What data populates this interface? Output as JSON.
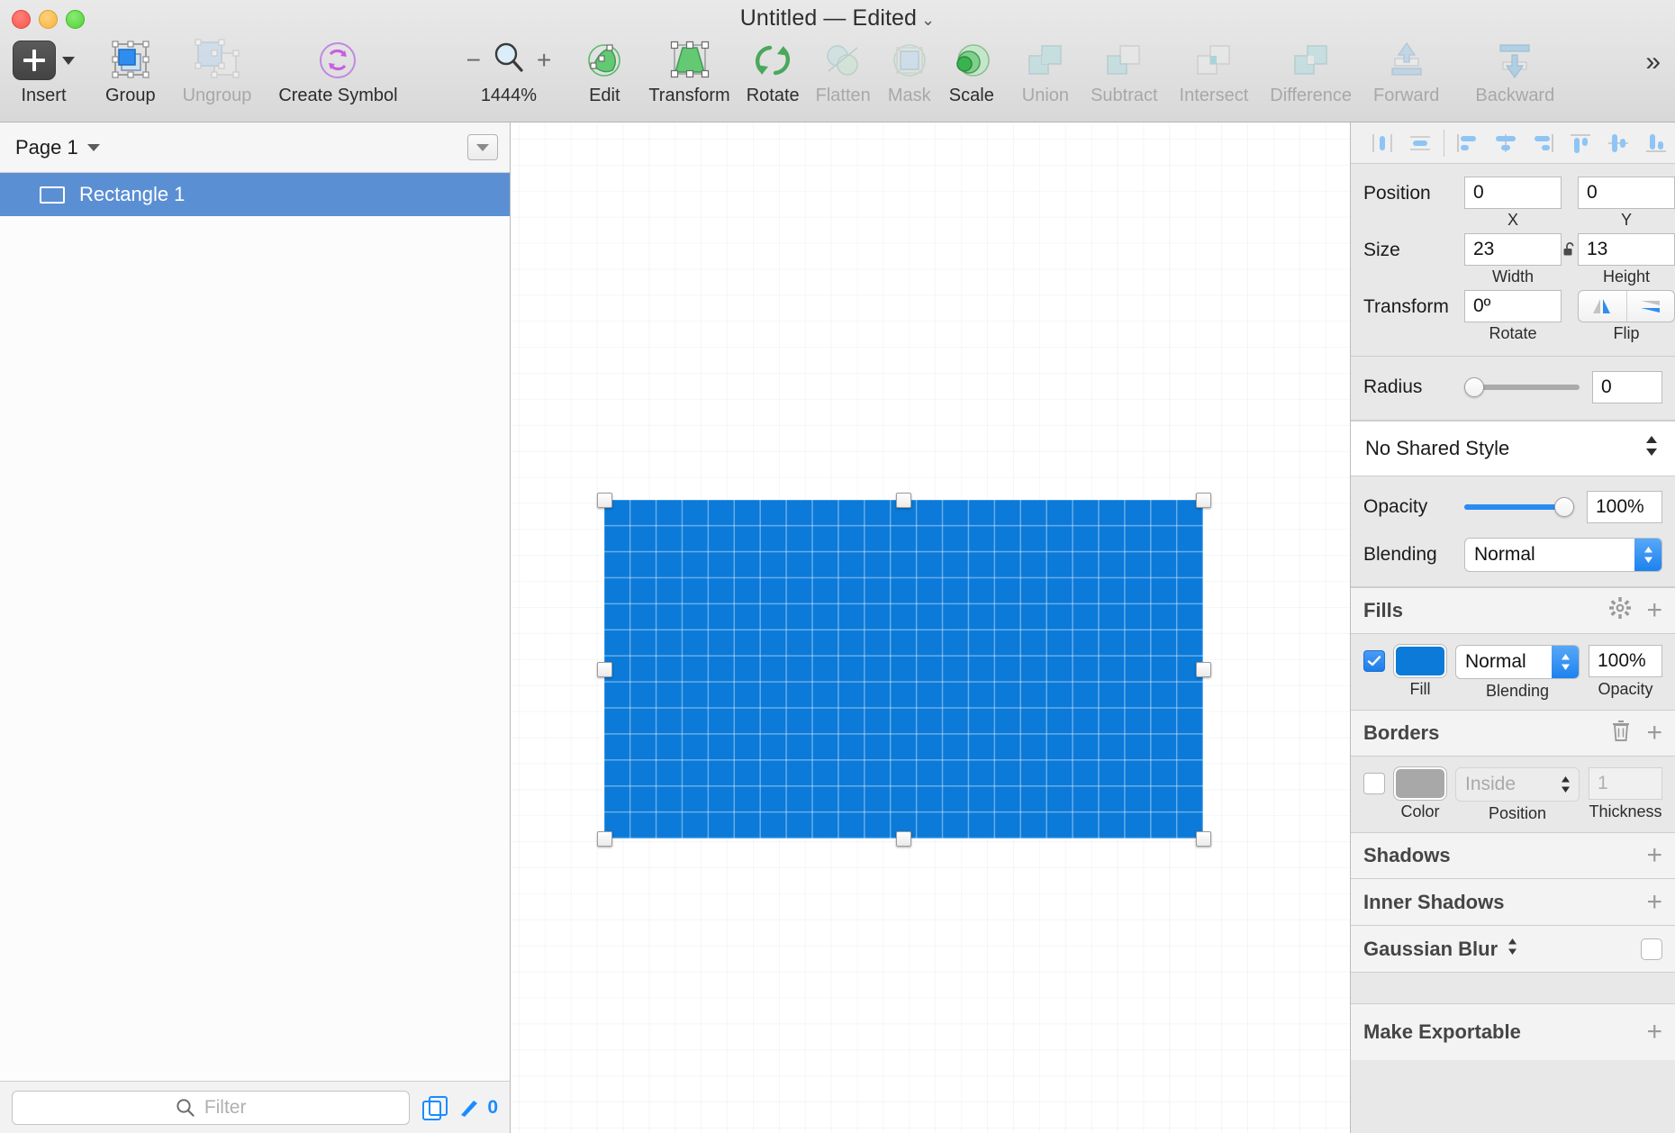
{
  "window": {
    "title": "Untitled — Edited",
    "title_chevron": "chevron-down-icon"
  },
  "toolbar": {
    "items": [
      {
        "label": "Insert",
        "icon": "insert-plus-icon",
        "enabled": true
      },
      {
        "label": "Group",
        "icon": "group-icon",
        "enabled": true
      },
      {
        "label": "Ungroup",
        "icon": "ungroup-icon",
        "enabled": false
      },
      {
        "label": "Create Symbol",
        "icon": "create-symbol-icon",
        "enabled": true
      },
      {
        "label": "Edit",
        "icon": "edit-icon",
        "enabled": true
      },
      {
        "label": "Transform",
        "icon": "transform-icon",
        "enabled": true
      },
      {
        "label": "Rotate",
        "icon": "rotate-icon",
        "enabled": true
      },
      {
        "label": "Flatten",
        "icon": "flatten-icon",
        "enabled": false
      },
      {
        "label": "Mask",
        "icon": "mask-icon",
        "enabled": false
      },
      {
        "label": "Scale",
        "icon": "scale-icon",
        "enabled": true
      },
      {
        "label": "Union",
        "icon": "union-icon",
        "enabled": false
      },
      {
        "label": "Subtract",
        "icon": "subtract-icon",
        "enabled": false
      },
      {
        "label": "Intersect",
        "icon": "intersect-icon",
        "enabled": false
      },
      {
        "label": "Difference",
        "icon": "difference-icon",
        "enabled": false
      },
      {
        "label": "Forward",
        "icon": "forward-icon",
        "enabled": false
      },
      {
        "label": "Backward",
        "icon": "backward-icon",
        "enabled": false
      }
    ],
    "zoom_level": "1444%",
    "zoom_out": "−",
    "zoom_in": "+",
    "overflow": "»"
  },
  "sidebar": {
    "page_name": "Page 1",
    "page_menu": "page-options-icon",
    "layers": [
      {
        "name": "Rectangle 1",
        "icon": "rectangle-shape-icon",
        "selected": true
      }
    ],
    "filter_placeholder": "Filter",
    "duplicate_icon": "duplicate-icon",
    "slice_icon": "slice-tool-icon",
    "slice_count": "0"
  },
  "canvas": {
    "shape_fill": "#0b7ad8",
    "pixel_grid": "on",
    "selection_handles": 8
  },
  "inspector": {
    "align_buttons": [
      "align-left-icon",
      "align-center-horizontal-icon",
      "align-left-edges-icon",
      "align-horizontal-centers-icon",
      "align-right-edges-icon",
      "align-top-edges-icon",
      "align-vertical-centers-icon",
      "align-bottom-edges-icon"
    ],
    "position": {
      "label": "Position",
      "x": "0",
      "y": "0",
      "x_label": "X",
      "y_label": "Y"
    },
    "size": {
      "label": "Size",
      "width": "23",
      "height": "13",
      "width_label": "Width",
      "height_label": "Height",
      "lock_icon": "unlocked-proportions-icon"
    },
    "transform": {
      "label": "Transform",
      "rotate": "0º",
      "rotate_label": "Rotate",
      "flip_label": "Flip",
      "flip_horizontal_icon": "flip-horizontal-icon",
      "flip_vertical_icon": "flip-vertical-icon"
    },
    "radius": {
      "label": "Radius",
      "value": "0",
      "slider_percent": 0
    },
    "shared_style": {
      "value": "No Shared Style",
      "stepper": "stepper-icon"
    },
    "opacity": {
      "label": "Opacity",
      "value": "100%",
      "slider_percent": 100
    },
    "blending": {
      "label": "Blending",
      "value": "Normal"
    },
    "fills": {
      "title": "Fills",
      "gear_icon": "gear-icon",
      "add_icon": "plus-icon",
      "enabled": true,
      "color": "#0b7ad8",
      "blending": "Normal",
      "opacity": "100%",
      "col_fill": "Fill",
      "col_blending": "Blending",
      "col_opacity": "Opacity"
    },
    "borders": {
      "title": "Borders",
      "delete_icon": "trash-icon",
      "add_icon": "plus-icon",
      "enabled": false,
      "color": "#a8a8a8",
      "position": "Inside",
      "thickness": "1",
      "col_color": "Color",
      "col_position": "Position",
      "col_thickness": "Thickness"
    },
    "shadows": {
      "title": "Shadows",
      "add_icon": "plus-icon"
    },
    "inner_shadows": {
      "title": "Inner Shadows",
      "add_icon": "plus-icon"
    },
    "gaussian_blur": {
      "title": "Gaussian Blur",
      "stepper": "stepper-icon",
      "enabled": false
    },
    "make_exportable": {
      "title": "Make Exportable",
      "add_icon": "plus-icon"
    }
  }
}
